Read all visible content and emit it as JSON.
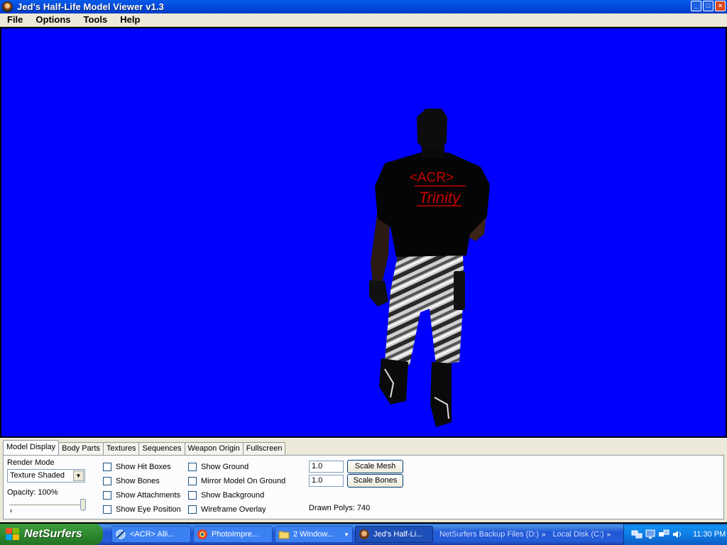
{
  "window": {
    "title": "Jed's Half-Life Model Viewer v1.3",
    "controls": [
      "_",
      "□",
      "×"
    ]
  },
  "menu": [
    "File",
    "Options",
    "Tools",
    "Help"
  ],
  "viewport": {
    "background": "#0000fe",
    "model_text": [
      "<ACR>",
      "Trinity"
    ]
  },
  "panel": {
    "tabs": [
      "Model Display",
      "Body Parts",
      "Textures",
      "Sequences",
      "Weapon Origin",
      "Fullscreen"
    ],
    "active_tab": "Model Display",
    "render_mode_label": "Render Mode",
    "render_mode_value": "Texture Shaded",
    "opacity_label": "Opacity: 100%",
    "opacity": 1.0,
    "checkboxes_col1": [
      "Show Hit Boxes",
      "Show Bones",
      "Show Attachments",
      "Show Eye Position"
    ],
    "checkboxes_col2": [
      "Show Ground",
      "Mirror Model On Ground",
      "Show Background",
      "Wireframe Overlay"
    ],
    "scale_mesh_value": "1.0",
    "scale_bones_value": "1.0",
    "scale_mesh_button": "Scale Mesh",
    "scale_bones_button": "Scale Bones",
    "drawn_polys": "Drawn Polys: 740"
  },
  "taskbar": {
    "start_label": "NetSurfers",
    "tasks": [
      "<ACR> Alli...",
      "PhotoImpre...",
      "2 Window...",
      "Jed's Half-Li..."
    ],
    "toolbar_links": [
      "NetSurfers Backup Files (D:)",
      "Local Disk (C:)"
    ],
    "clock": "11:30 PM"
  }
}
